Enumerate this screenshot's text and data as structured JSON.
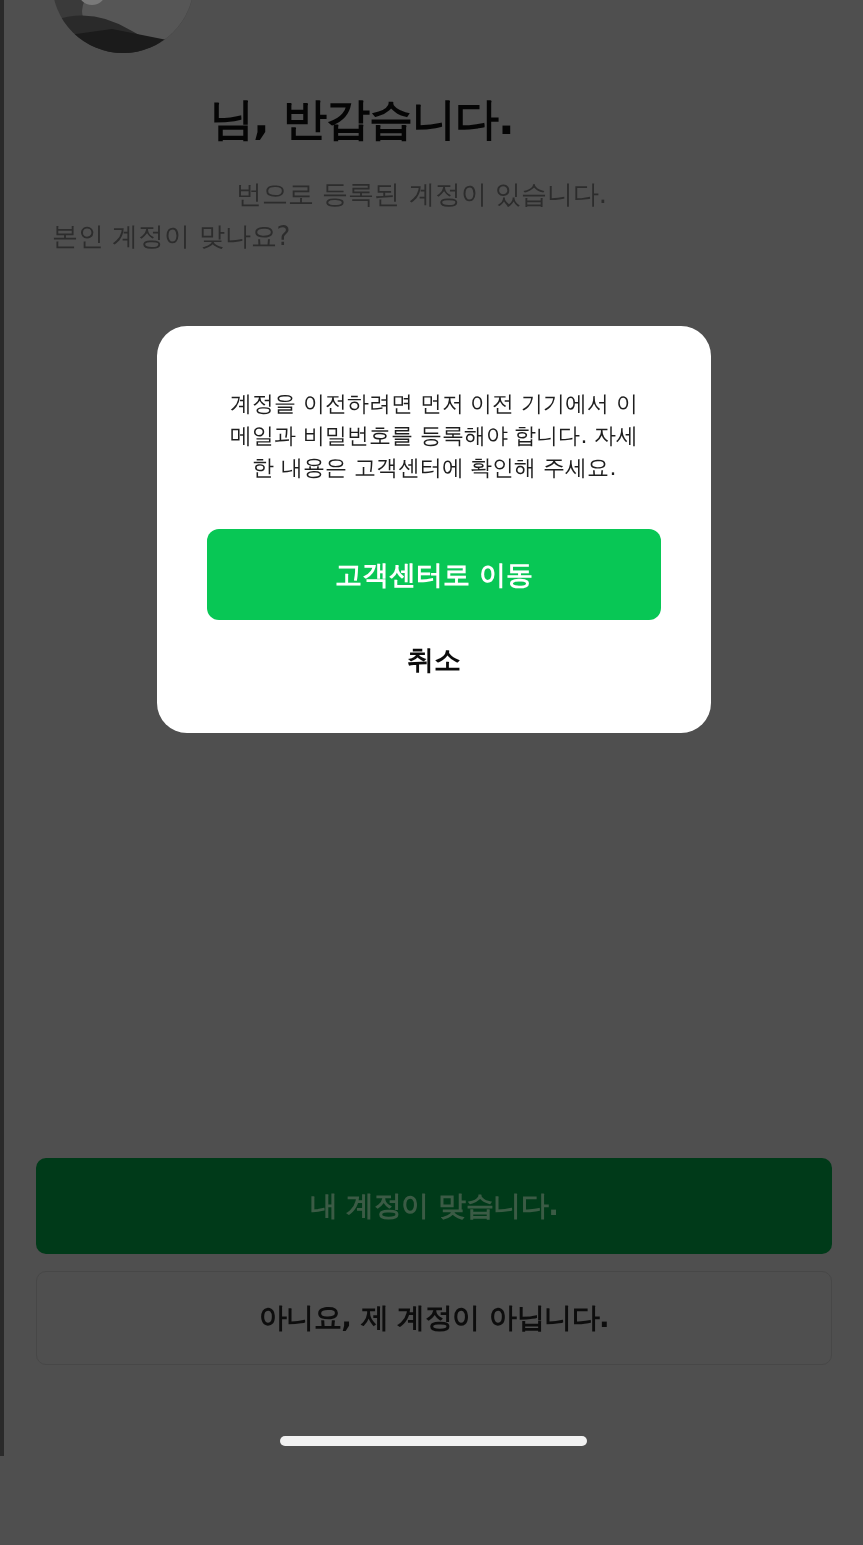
{
  "greeting": {
    "title": "님, 반갑습니다.",
    "message_lines": [
      "번으로 등록된 계정이 있습니다.",
      "본인 계정이 맞나요?"
    ]
  },
  "actions": [
    {
      "label": "내 계정이 맞습니다.",
      "kind": "primary"
    },
    {
      "label": "아니요, 제 계정이 아닙니다.",
      "kind": "secondary"
    }
  ],
  "dialog": {
    "message_lines": [
      "계정을 이전하려면 먼저 이전 기기에서 이",
      "메일과 비밀번호를 등록해야 합니다. 자세",
      "한 내용은 고객센터에 확인해 주세요."
    ],
    "buttons": [
      {
        "label": "고객센터로 이동",
        "kind": "primary"
      },
      {
        "label": "취소",
        "kind": "text"
      }
    ]
  }
}
